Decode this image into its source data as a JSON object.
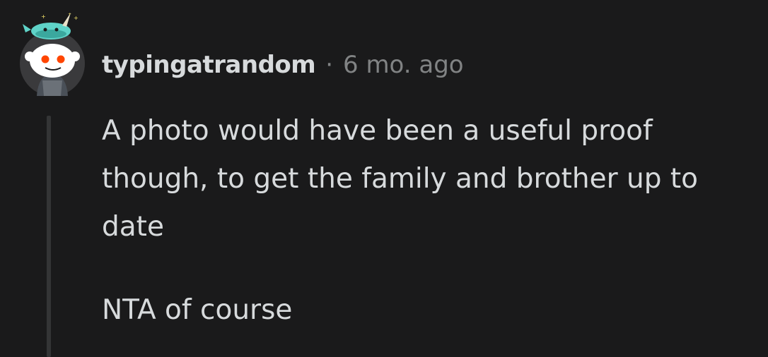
{
  "comment": {
    "username": "typingatrandom",
    "separator": "·",
    "timestamp": "6 mo. ago",
    "paragraphs": [
      "A photo would have been a useful proof though, to get the family and brother up to date",
      "NTA of course"
    ]
  },
  "colors": {
    "background": "#1a1a1b",
    "text": "#d7dadc",
    "meta": "#818384",
    "thread_line": "#343536",
    "avatar_accent": "#5fd3c8",
    "avatar_eye": "#ff4500"
  },
  "icons": {
    "avatar": "snoo-avatar-icon",
    "hat": "narwhal-hat-icon"
  }
}
